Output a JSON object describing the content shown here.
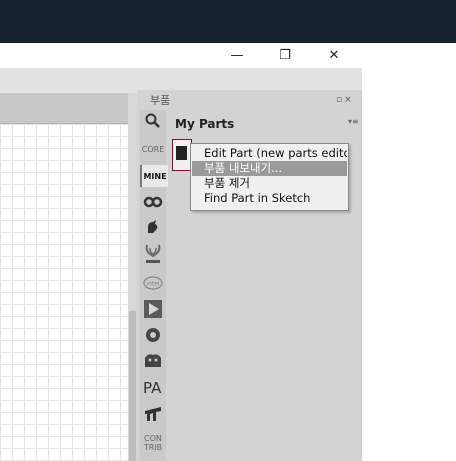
{
  "window": {
    "minimize_glyph": "—",
    "restore_glyph": "❐",
    "close_glyph": "✕"
  },
  "dock": {
    "title": "부품",
    "controls": "▫×"
  },
  "bins": {
    "core_label": "CORE",
    "mine_label": "MINE",
    "contrib_label": "CON\nTRIB",
    "icons": [
      "search-icon",
      "arduino-icon",
      "sparkfun-icon",
      "seeed-icon",
      "intel-icon",
      "snootlab-icon",
      "adafruit-icon",
      "animal-icon",
      "pa-icon",
      "fritzing-icon"
    ]
  },
  "bin": {
    "title": "My Parts",
    "menu_glyph": "▾≡"
  },
  "context_menu": {
    "items": [
      "Edit Part (new parts editc",
      "부품 내보내기...",
      "부품 제거",
      "Find Part in Sketch"
    ],
    "highlighted_index": 1
  },
  "colors": {
    "topbar": "#14232e",
    "dock_bg": "#d3d3d3",
    "highlight": "#9a9a9a",
    "part_border": "#a0002c"
  }
}
